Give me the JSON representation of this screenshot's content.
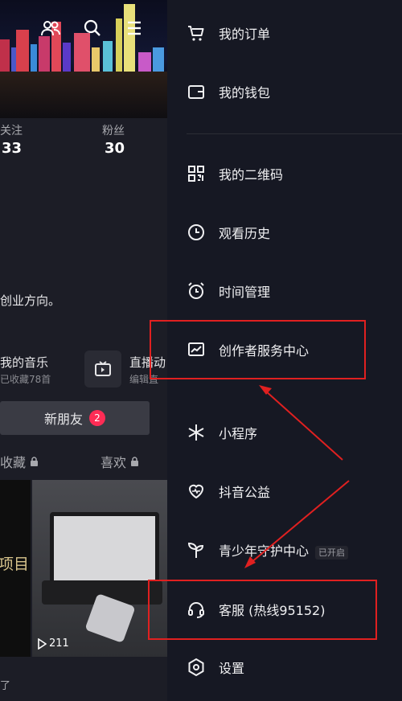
{
  "profile": {
    "stats": [
      {
        "label": "关注",
        "value": "33"
      },
      {
        "label": "粉丝",
        "value": "30"
      }
    ],
    "bio": "创业方向。",
    "music": {
      "title": "我的音乐",
      "subtitle": "已收藏78首"
    },
    "live": {
      "title": "直播动",
      "subtitle": "编辑直"
    },
    "new_friends": {
      "label": "新朋友",
      "count": "2"
    },
    "tabs": [
      "收藏",
      "喜欢"
    ],
    "video_play_count": "211",
    "thumb_text": "项目",
    "bottom_text": "了"
  },
  "drawer": {
    "items": [
      {
        "label": "我的订单",
        "icon": "cart-icon"
      },
      {
        "label": "我的钱包",
        "icon": "wallet-icon"
      },
      {
        "label": "我的二维码",
        "icon": "qrcode-icon"
      },
      {
        "label": "观看历史",
        "icon": "clock-icon"
      },
      {
        "label": "时间管理",
        "icon": "alarm-icon"
      },
      {
        "label": "创作者服务中心",
        "icon": "chart-icon"
      },
      {
        "label": "小程序",
        "icon": "asterisk-icon"
      },
      {
        "label": "抖音公益",
        "icon": "heart-icon"
      },
      {
        "label": "青少年守护中心",
        "icon": "sprout-icon",
        "tag": "已开启"
      },
      {
        "label": "客服 (热线95152)",
        "icon": "headset-icon"
      },
      {
        "label": "设置",
        "icon": "settings-icon"
      }
    ]
  },
  "colors": {
    "accent": "#fe2c55",
    "highlight": "#e02020",
    "drawer_bg": "#161823"
  }
}
